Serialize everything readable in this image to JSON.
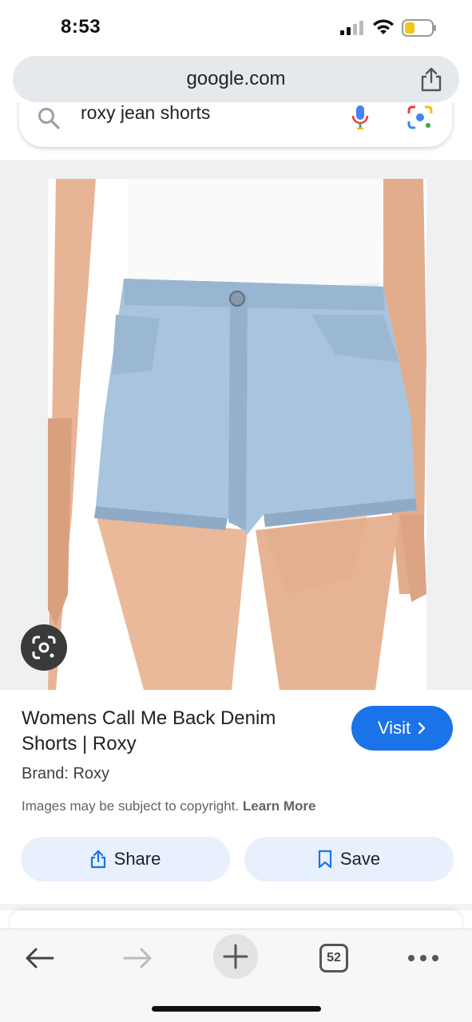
{
  "status_bar": {
    "time": "8:53"
  },
  "browser": {
    "url": "google.com",
    "tab_count": "52"
  },
  "search": {
    "query": "roxy jean shorts"
  },
  "result": {
    "title": "Womens Call Me Back Denim Shorts | Roxy",
    "brand": "Brand: Roxy",
    "copyright_text": "Images may be subject to copyright.",
    "learn_more": "Learn More",
    "visit_label": "Visit",
    "share_label": "Share",
    "save_label": "Save"
  },
  "colors": {
    "accent": "#1a73e8",
    "pill_bg": "#e8f0fe",
    "url_bar_bg": "#e6e9ec"
  }
}
